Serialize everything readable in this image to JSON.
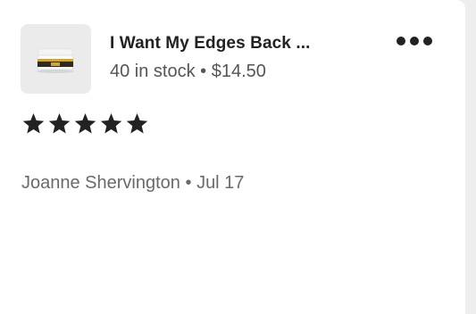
{
  "listing": {
    "title": "I Want My Edges Back ...",
    "stock": "40 in stock",
    "separator": "•",
    "price": "$14.50",
    "thumbnail_icon": "product-jar-image"
  },
  "menu": {
    "icon": "more-options-icon"
  },
  "review": {
    "rating": 5,
    "rating_max": 5,
    "star_color": "#222222",
    "reviewer": "Joanne Shervington",
    "separator": "•",
    "date": "Jul 17"
  }
}
